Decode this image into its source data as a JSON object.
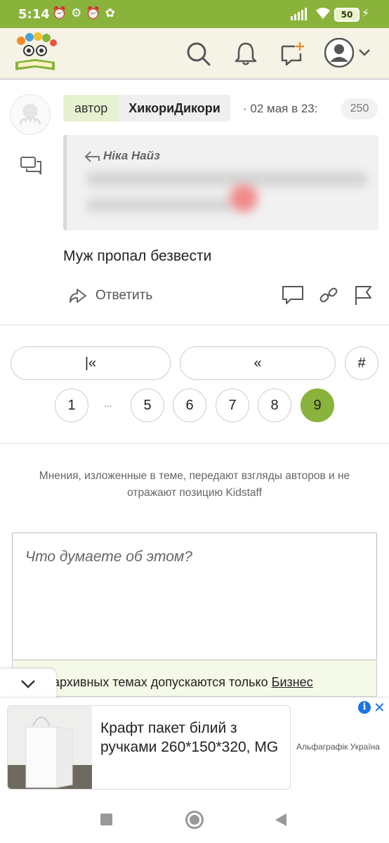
{
  "status_bar": {
    "time": "5:14",
    "battery": "50"
  },
  "header": {
    "logo_alt": "Kidstaff",
    "icons": [
      "search-icon",
      "bell-icon",
      "new-message-icon",
      "profile-avatar-icon",
      "chevron-down-icon"
    ]
  },
  "post": {
    "author_label": "автор",
    "author_name": "ХикориДикори",
    "date": "02 мая в 23:",
    "reply_count": "250",
    "quote_author": "Ніка Найз",
    "text": "Муж пропал безвести",
    "reply_label": "Ответить"
  },
  "pagination": {
    "first": "|«",
    "prev": "«",
    "jump": "#",
    "pages": [
      "1",
      "5",
      "6",
      "7",
      "8",
      "9"
    ],
    "ellipsis": "...",
    "current": "9"
  },
  "disclaimer": "Мнения, изложенные в теме, передают взгляды авторов и не отражают позицию Kidstaff",
  "composer": {
    "placeholder": "Что думаете об этом?",
    "notice_prefix": "В архивных темах допускаются только ",
    "notice_link": "Бизнес"
  },
  "ad": {
    "title": "Крафт пакет білий з ручками 260*150*320, MG",
    "brand": "Альфаграфік Україна"
  },
  "colors": {
    "accent": "#8ab33c",
    "header_bg": "#f5f3e6"
  }
}
